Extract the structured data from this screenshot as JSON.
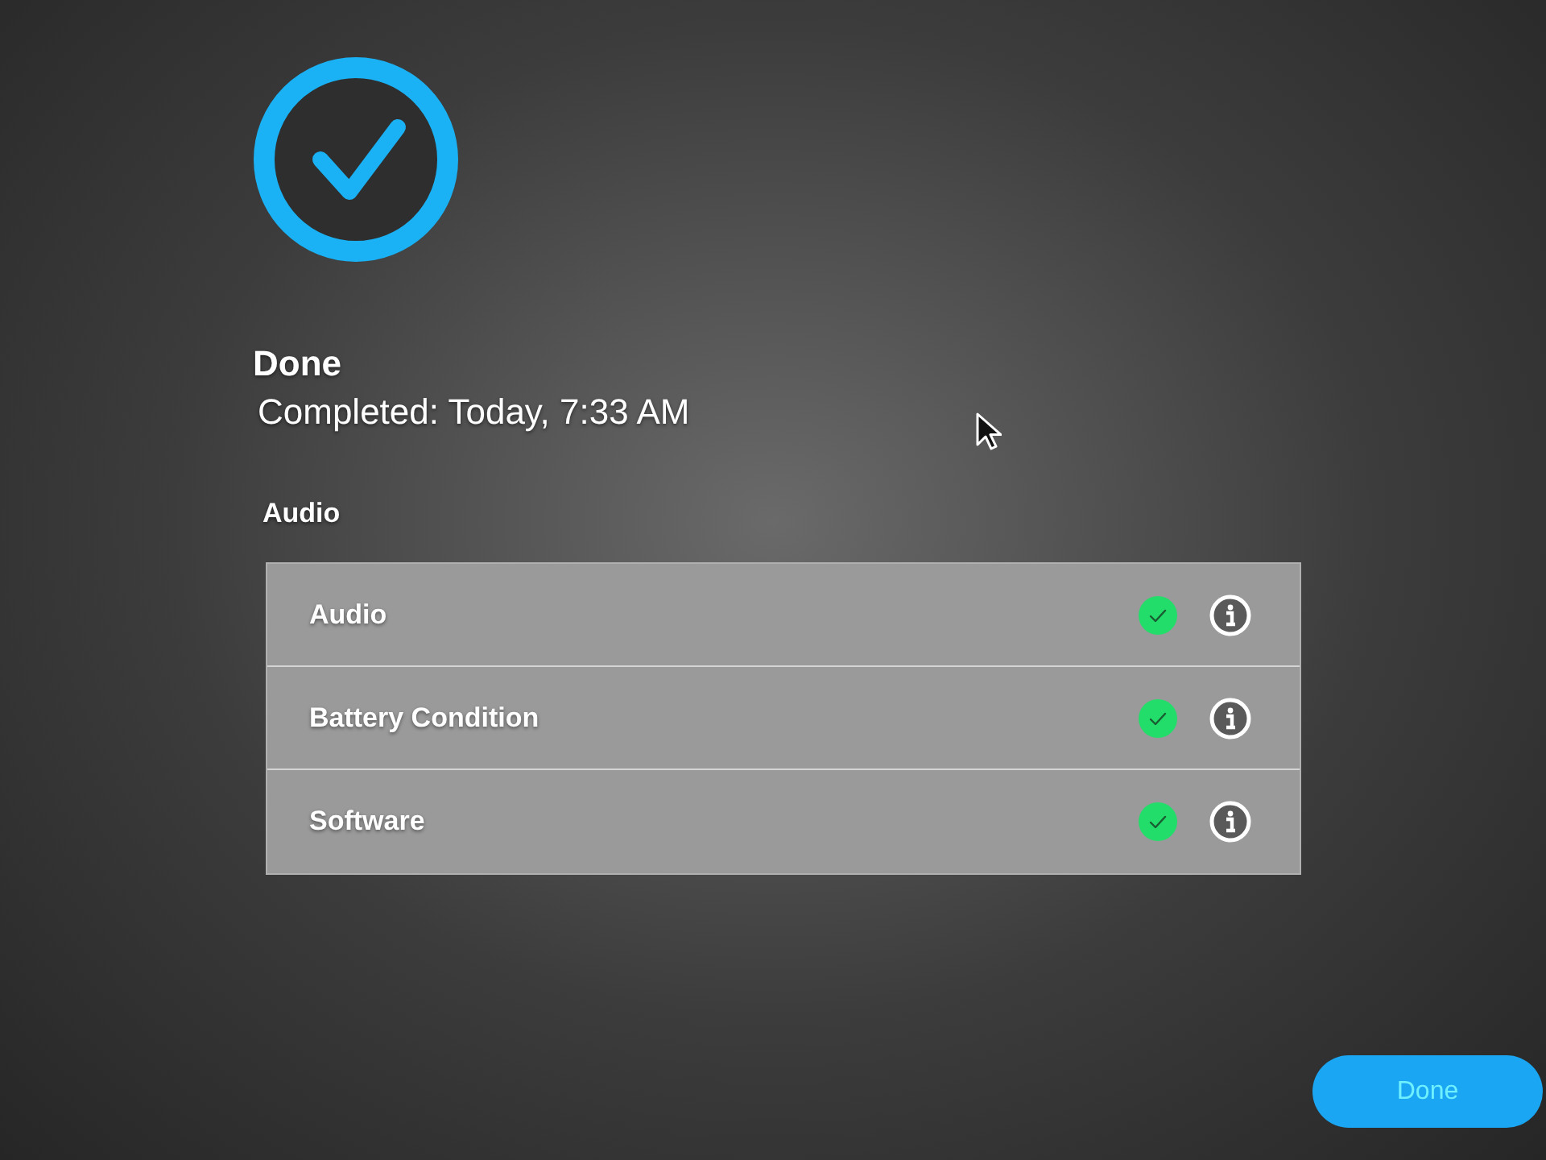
{
  "header": {
    "title": "Done",
    "subtitle": "Completed: Today, 7:33 AM"
  },
  "section": {
    "title": "Audio",
    "rows": [
      {
        "label": "Audio",
        "passed": true
      },
      {
        "label": "Battery Condition",
        "passed": true
      },
      {
        "label": "Software",
        "passed": true
      }
    ]
  },
  "buttons": [
    {
      "label": "Done"
    }
  ]
}
